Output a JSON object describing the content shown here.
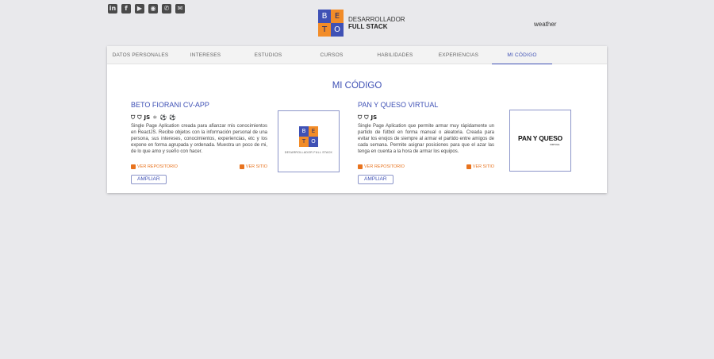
{
  "header": {
    "social_icons": [
      {
        "icon": "linkedin-icon",
        "glyph": "in"
      },
      {
        "icon": "facebook-icon",
        "glyph": "f"
      },
      {
        "icon": "youtube-icon",
        "glyph": "▶"
      },
      {
        "icon": "github-icon",
        "glyph": "◉"
      },
      {
        "icon": "whatsapp-icon",
        "glyph": "✆"
      },
      {
        "icon": "email-icon",
        "glyph": "✉"
      }
    ],
    "logo": {
      "letters": [
        "B",
        "E",
        "T",
        "O"
      ],
      "line1": "DESARROLLADOR",
      "line2": "FULL STACK"
    },
    "weather": "weather"
  },
  "tabs": [
    {
      "label": "DATOS PERSONALES",
      "active": false
    },
    {
      "label": "INTERESES",
      "active": false
    },
    {
      "label": "ESTUDIOS",
      "active": false
    },
    {
      "label": "CURSOS",
      "active": false
    },
    {
      "label": "HABILIDADES",
      "active": false
    },
    {
      "label": "EXPERIENCIAS",
      "active": false
    },
    {
      "label": "MI CÓDIGO",
      "active": true
    }
  ],
  "section": {
    "title": "MI CÓDIGO"
  },
  "projects": [
    {
      "title": "BETO FIORANI CV-APP",
      "tech_icons": [
        "html5-icon",
        "css3-icon",
        "js-icon",
        "react-icon",
        "redux-icon",
        "soccer-ball-icon"
      ],
      "tech_glyphs": [
        "⛉",
        "⛉",
        "JS",
        "⚛",
        "⚽",
        "⚽"
      ],
      "description": "Single Page Aplication creada para afianzar mis conocimientos en ReactJS. Recibe objetos con la información personal de una persona, sus intereses, conocimientos, experiencias, etc y los expone en forma agrupada y ordenada. Muestra un poco de mi, de lo que amo y sueño con hacer.",
      "repo_link": "VER REPOSITORIO",
      "site_link": "VER SITIO",
      "button": "AMPLIAR",
      "thumb_caption": "DESARROLLADOR FULL STACK"
    },
    {
      "title": "PAN Y QUESO VIRTUAL",
      "tech_icons": [
        "html5-icon",
        "css3-icon",
        "js-icon"
      ],
      "tech_glyphs": [
        "⛉",
        "⛉",
        "JS"
      ],
      "description": "Single Page Aplication que permite armar muy rápidamente un partido de fútbol en forma manual o aleatoria. Creada para evitar los enojos de siempre al armar el partido entre amigos de cada semana. Permite asignar posiciones para que el azar las tenga en cuenta a la hora de armar los equipos.",
      "repo_link": "VER REPOSITORIO",
      "site_link": "VER SITIO",
      "button": "AMPLIAR",
      "thumb_title": "PAN Y QUESO",
      "thumb_sub": "VIRTUAL"
    }
  ],
  "colors": {
    "accent": "#3f51b5",
    "orange": "#f28c28",
    "background": "#e9e9ec"
  }
}
